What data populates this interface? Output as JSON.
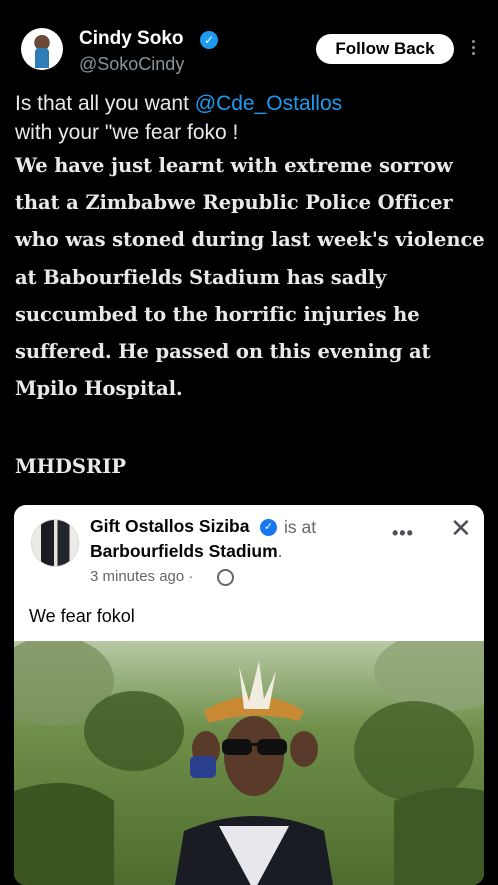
{
  "tweet": {
    "author": {
      "display_name": "Cindy Soko",
      "handle": "@SokoCindy",
      "verified": true
    },
    "follow_button_label": "Follow Back",
    "text_line1_prefix": "Is that all you want ",
    "mention": "@Cde_Ostallos",
    "text_line2": "with your \"we fear foko !",
    "quoted_message": "We have just learnt with extreme sorrow that a Zimbabwe Republic Police Officer who was stoned during last week's violence at Babourfields Stadium has sadly succumbed to the horrific injuries he suffered. He passed on this evening at Mpilo Hospital.",
    "signature": "MHDSRIP"
  },
  "facebook_post": {
    "author_name": "Gift Ostallos Siziba",
    "verified": true,
    "is_at_label": "is at",
    "location": "Barbourfields Stadium",
    "location_period": ".",
    "time": "3 minutes ago",
    "time_separator": "·",
    "post_text": "We fear fokol",
    "more_label": "•••",
    "close_label": "✕"
  },
  "colors": {
    "background": "#000000",
    "mention": "#1d9bf0",
    "verified_badge": "#1d9bf0",
    "fb_verified_badge": "#1877f2"
  },
  "icons": {
    "verified": "verified-badge-icon",
    "more": "vertical-ellipsis-icon",
    "globe": "globe-icon",
    "close": "close-icon"
  }
}
